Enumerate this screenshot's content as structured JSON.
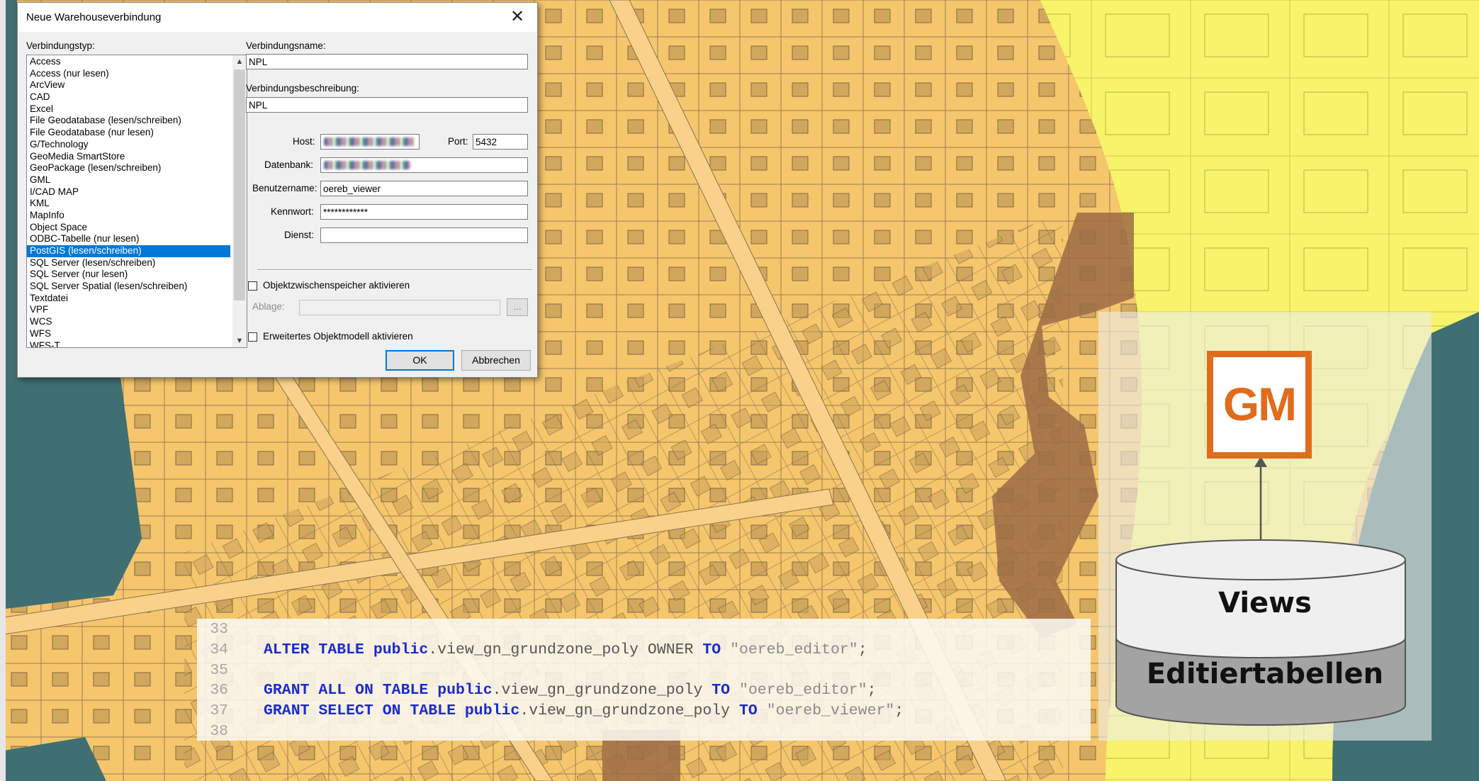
{
  "dialog": {
    "title": "Neue Warehouseverbindung",
    "close_glyph": "✕",
    "connection_type_label": "Verbindungstyp:",
    "connection_types": [
      "Access",
      "Access (nur lesen)",
      "ArcView",
      "CAD",
      "Excel",
      "File Geodatabase (lesen/schreiben)",
      "File Geodatabase (nur lesen)",
      "G/Technology",
      "GeoMedia SmartStore",
      "GeoPackage (lesen/schreiben)",
      "GML",
      "I/CAD MAP",
      "KML",
      "MapInfo",
      "Object Space",
      "ODBC-Tabelle (nur lesen)",
      "PostGIS (lesen/schreiben)",
      "SQL Server (lesen/schreiben)",
      "SQL Server (nur lesen)",
      "SQL Server Spatial (lesen/schreiben)",
      "Textdatei",
      "VPF",
      "WCS",
      "WFS",
      "WFS-T"
    ],
    "selected_type": "PostGIS (lesen/schreiben)",
    "connection_name_label": "Verbindungsname:",
    "connection_name_value": "NPL",
    "connection_description_label": "Verbindungsbeschreibung:",
    "connection_description_value": "NPL",
    "host_label": "Host:",
    "port_label": "Port:",
    "port_value": "5432",
    "database_label": "Datenbank:",
    "username_label": "Benutzername:",
    "username_value": "oereb_viewer",
    "password_label": "Kennwort:",
    "password_value": "************",
    "service_label": "Dienst:",
    "service_value": "",
    "cache_checkbox_label": "Objektzwischenspeicher aktivieren",
    "cache_checked": false,
    "storage_label": "Ablage:",
    "browse_label": "...",
    "extended_model_checkbox_label": "Erweitertes Objektmodell aktivieren",
    "extended_model_checked": false,
    "ok_label": "OK",
    "cancel_label": "Abbrechen"
  },
  "code_snippet": {
    "lines": [
      {
        "num": "33",
        "tokens": []
      },
      {
        "num": "34",
        "tokens": [
          {
            "t": "ALTER",
            "c": "kw"
          },
          {
            "t": " "
          },
          {
            "t": "TABLE",
            "c": "kw"
          },
          {
            "t": " "
          },
          {
            "t": "public",
            "c": "kw"
          },
          {
            "t": ".view_gn_grundzone_poly OWNER "
          },
          {
            "t": "TO",
            "c": "kw"
          },
          {
            "t": " "
          },
          {
            "t": "\"oereb_editor\"",
            "c": "str"
          },
          {
            "t": ";"
          }
        ]
      },
      {
        "num": "35",
        "tokens": []
      },
      {
        "num": "36",
        "tokens": [
          {
            "t": "GRANT",
            "c": "kw"
          },
          {
            "t": " "
          },
          {
            "t": "ALL",
            "c": "kw"
          },
          {
            "t": " "
          },
          {
            "t": "ON",
            "c": "kw"
          },
          {
            "t": " "
          },
          {
            "t": "TABLE",
            "c": "kw"
          },
          {
            "t": " "
          },
          {
            "t": "public",
            "c": "kw"
          },
          {
            "t": ".view_gn_grundzone_poly "
          },
          {
            "t": "TO",
            "c": "kw"
          },
          {
            "t": " "
          },
          {
            "t": "\"oereb_editor\"",
            "c": "str"
          },
          {
            "t": ";"
          }
        ]
      },
      {
        "num": "37",
        "tokens": [
          {
            "t": "GRANT",
            "c": "kw"
          },
          {
            "t": " "
          },
          {
            "t": "SELECT",
            "c": "kw"
          },
          {
            "t": " "
          },
          {
            "t": "ON",
            "c": "kw"
          },
          {
            "t": " "
          },
          {
            "t": "TABLE",
            "c": "kw"
          },
          {
            "t": " "
          },
          {
            "t": "public",
            "c": "kw"
          },
          {
            "t": ".view_gn_grundzone_poly "
          },
          {
            "t": "TO",
            "c": "kw"
          },
          {
            "t": " "
          },
          {
            "t": "\"oereb_viewer\"",
            "c": "str"
          },
          {
            "t": ";"
          }
        ]
      },
      {
        "num": "38",
        "tokens": []
      }
    ]
  },
  "diagram": {
    "app_icon_text": "GM",
    "db_top_label": "Views",
    "db_bottom_label": "Editiertabellen"
  },
  "colors": {
    "zone_residential": "#f6c66c",
    "zone_industrial": "#f7f36a",
    "zone_special": "#9c6b45",
    "forest": "#3f6f73",
    "selection": "#0078d7",
    "gm_orange": "#e06c1c",
    "sql_keyword": "#1b2bd0"
  }
}
